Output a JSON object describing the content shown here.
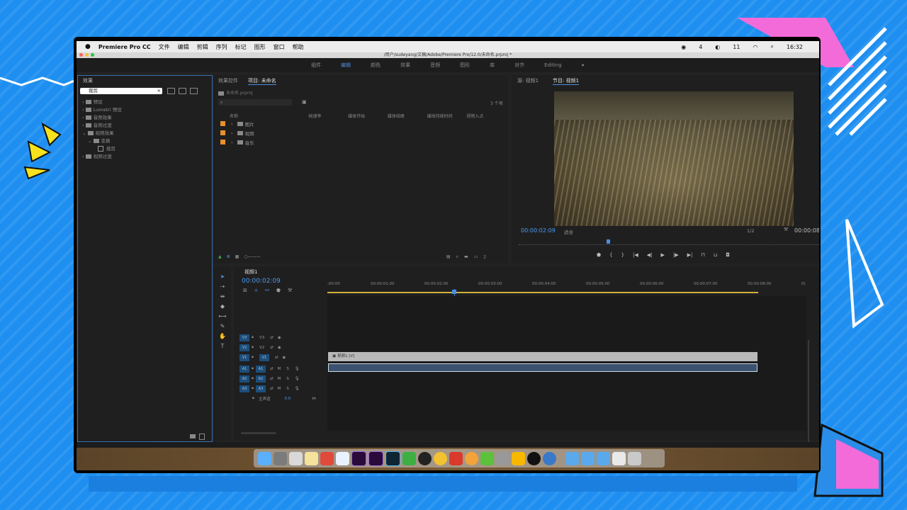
{
  "menubar": {
    "app_name": "Premiere Pro CC",
    "items": [
      "文件",
      "编辑",
      "剪辑",
      "序列",
      "标记",
      "图形",
      "窗口",
      "帮助"
    ],
    "status_right": [
      "4",
      "11"
    ],
    "clock": "16:32"
  },
  "window": {
    "title": "/用户/sudeyang/文稿/Adobe/Premiere Pro/12.0/未命名.prproj *"
  },
  "workspaces": {
    "items": [
      "组件",
      "编辑",
      "颜色",
      "效果",
      "音频",
      "图形",
      "库",
      "对齐",
      "Editing"
    ],
    "active": "编辑",
    "more": "»"
  },
  "effects_panel": {
    "title": "效果",
    "search_value": "裁剪",
    "tree": [
      {
        "label": "预设",
        "depth": 0
      },
      {
        "label": "Lumetri 预设",
        "depth": 0
      },
      {
        "label": "音频效果",
        "depth": 0
      },
      {
        "label": "音频过渡",
        "depth": 0
      },
      {
        "label": "视频效果",
        "depth": 0
      },
      {
        "label": "变换",
        "depth": 1
      },
      {
        "label": "裁剪",
        "depth": 2
      },
      {
        "label": "视频过渡",
        "depth": 0
      }
    ]
  },
  "project_panel": {
    "tabs": [
      "效果控件",
      "项目: 未命名"
    ],
    "active_tab": "项目: 未命名",
    "project_file": "未命名.prproj",
    "item_count": "3 个项",
    "columns": [
      "名称",
      "帧速率",
      "媒体开始",
      "媒体结尾",
      "媒体持续时间",
      "视频入点"
    ],
    "items": [
      {
        "name": "图片",
        "color": "#e8902b"
      },
      {
        "name": "视频",
        "color": "#e8902b"
      },
      {
        "name": "音乐",
        "color": "#e8902b"
      }
    ]
  },
  "source_monitor": {
    "tab": "源: 视频1"
  },
  "program_monitor": {
    "tab": "节目: 视频1",
    "timecode": "00:00:02:09",
    "fit": "适合",
    "resolution": "1/2",
    "end_timecode": "00:00:08:"
  },
  "timeline": {
    "sequence_tab": "视频1",
    "timecode": "00:00:02:09",
    "ruler": [
      ":00:00",
      "00:00:01:00",
      "00:00:02:00",
      "00:00:03:00",
      "00:00:04:00",
      "00:00:05:00",
      "00:00:06:00",
      "00:00:07:00",
      "00:00:08:00",
      "0("
    ],
    "video_tracks": [
      "V3",
      "V2",
      "V1"
    ],
    "audio_tracks": [
      "A1",
      "A2",
      "A3"
    ],
    "master_label": "主声道",
    "master_value": "0.0",
    "video_clip_label": "视频1 [V]"
  }
}
